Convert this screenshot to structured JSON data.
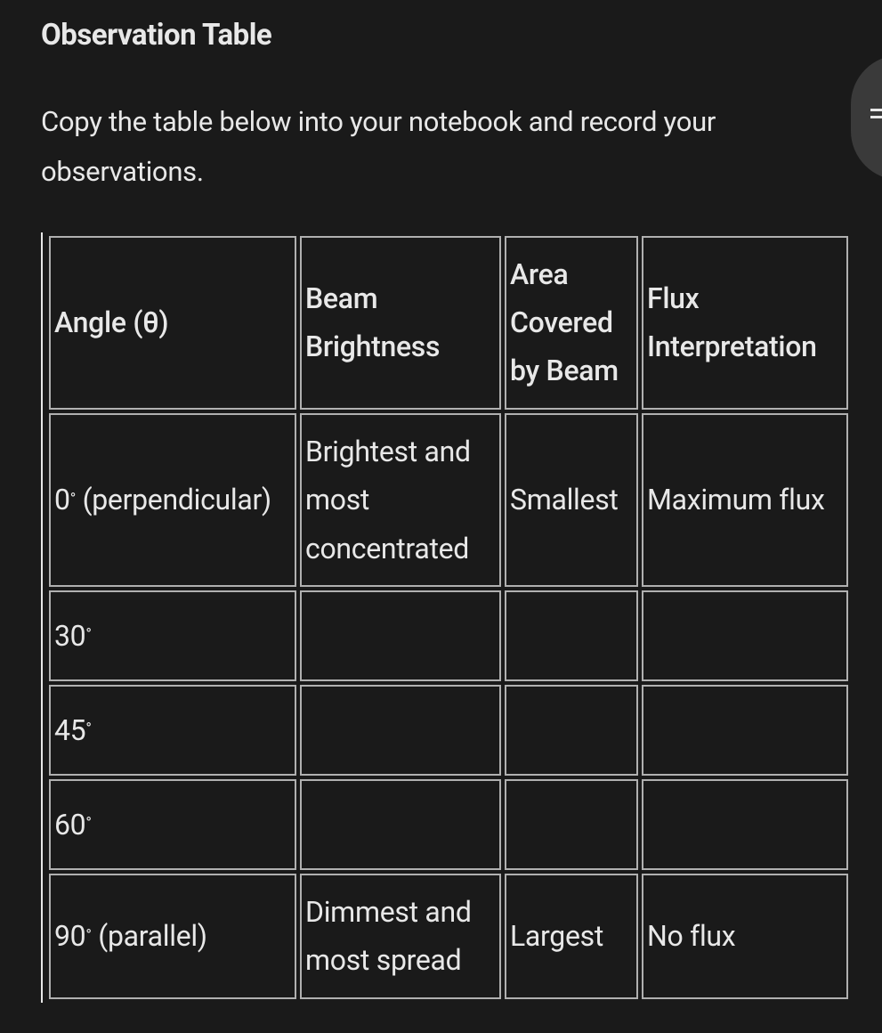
{
  "heading": "Observation Table",
  "instruction": "Copy the table below into your notebook and record your observations.",
  "table": {
    "headers": {
      "angle": "Angle (θ)",
      "brightness": "Beam Brightness",
      "area": "Area Covered by Beam",
      "flux": "Flux Interpretation"
    },
    "rows": [
      {
        "angle_num": "0",
        "angle_suffix": " (perpendicular)",
        "brightness": "Brightest and most concentrated",
        "area": "Smallest",
        "flux": "Maximum flux"
      },
      {
        "angle_num": "30",
        "angle_suffix": "",
        "brightness": "",
        "area": "",
        "flux": ""
      },
      {
        "angle_num": "45",
        "angle_suffix": "",
        "brightness": "",
        "area": "",
        "flux": ""
      },
      {
        "angle_num": "60",
        "angle_suffix": "",
        "brightness": "",
        "area": "",
        "flux": ""
      },
      {
        "angle_num": "90",
        "angle_suffix": " (parallel)",
        "brightness": "Dimmest and most spread",
        "area": "Largest",
        "flux": "No flux"
      }
    ]
  },
  "chart_data": {
    "type": "table",
    "title": "Observation Table",
    "columns": [
      "Angle (θ)",
      "Beam Brightness",
      "Area Covered by Beam",
      "Flux Interpretation"
    ],
    "rows": [
      [
        "0° (perpendicular)",
        "Brightest and most concentrated",
        "Smallest",
        "Maximum flux"
      ],
      [
        "30°",
        "",
        "",
        ""
      ],
      [
        "45°",
        "",
        "",
        ""
      ],
      [
        "60°",
        "",
        "",
        ""
      ],
      [
        "90° (parallel)",
        "Dimmest and most spread",
        "Largest",
        "No flux"
      ]
    ]
  }
}
